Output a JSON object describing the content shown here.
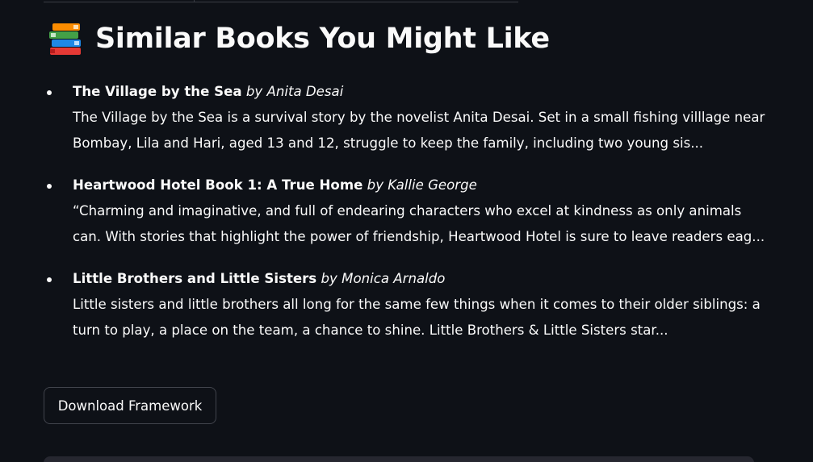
{
  "heading": {
    "icon": "books-icon",
    "title": "Similar Books You Might Like"
  },
  "books": [
    {
      "title": "The Village by the Sea",
      "by": "by",
      "author": "Anita Desai",
      "description": "The Village by the Sea is a survival story by the novelist Anita Desai. Set in a small fishing villlage near Bombay, Lila and Hari, aged 13 and 12, struggle to keep the family, including two young sis..."
    },
    {
      "title": "Heartwood Hotel Book 1: A True Home",
      "by": "by",
      "author": "Kallie George",
      "description": "“Charming and imaginative, and full of endearing characters who excel at kindness as only animals can. With stories that highlight the power of friendship, Heartwood Hotel is sure to leave readers eag..."
    },
    {
      "title": "Little Brothers and Little Sisters",
      "by": "by",
      "author": "Monica Arnaldo",
      "description": "Little sisters and little brothers all long for the same few things when it comes to their older siblings: a turn to play, a place on the team, a chance to shine. Little Brothers & Little Sisters star..."
    }
  ],
  "download_button": {
    "label": "Download Framework"
  },
  "colors": {
    "background": "#0e1117",
    "text": "#fafafa",
    "button_border": "#41444c"
  }
}
